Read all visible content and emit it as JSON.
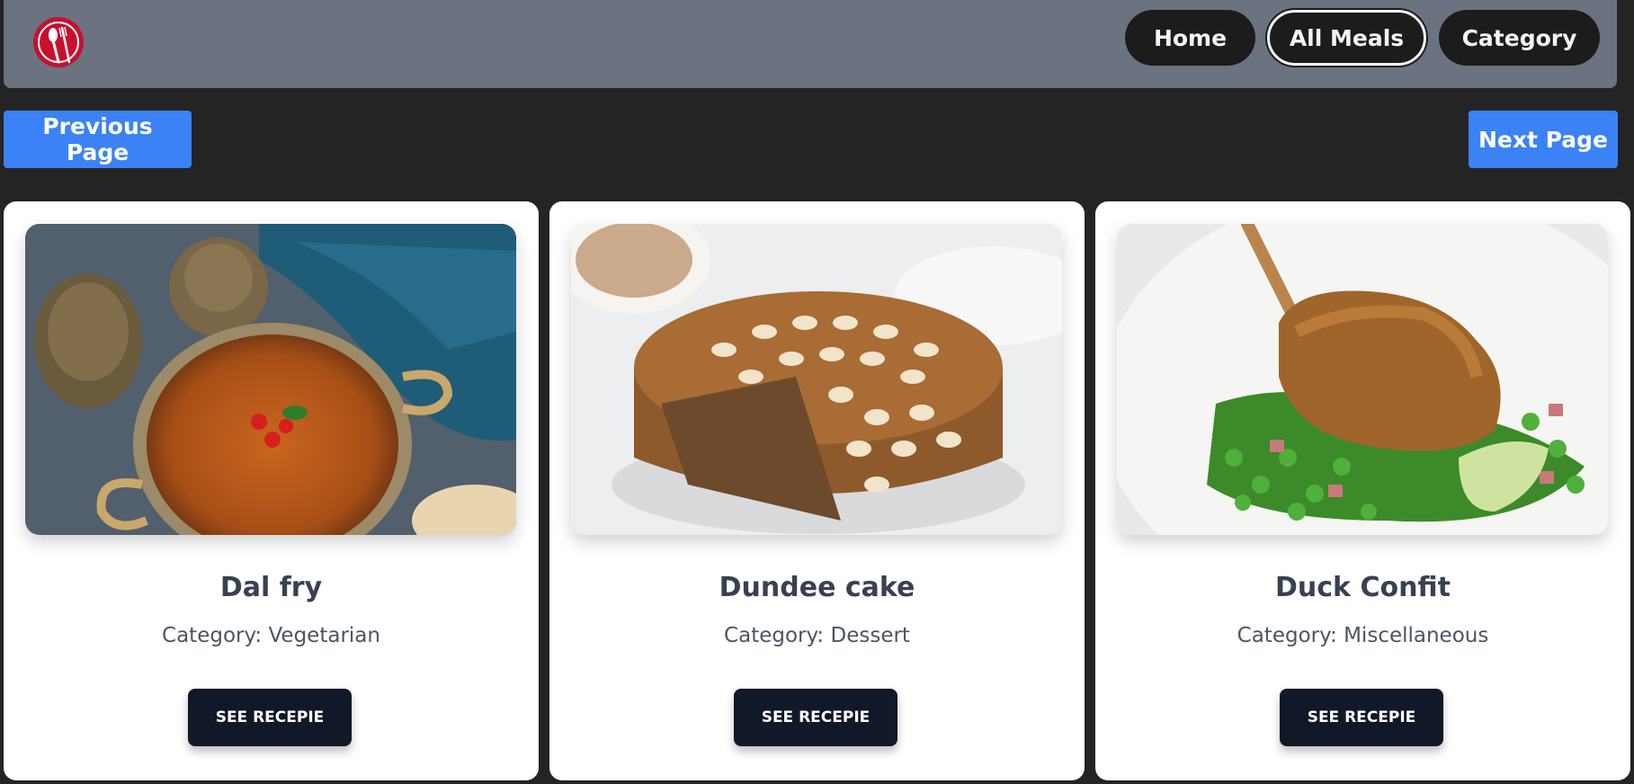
{
  "nav": {
    "home_label": "Home",
    "all_meals_label": "All Meals",
    "category_label": "Category"
  },
  "pagination": {
    "previous_label": "Previous Page",
    "next_label": "Next Page"
  },
  "meals": [
    {
      "title": "Dal fry",
      "category": "Category: Vegetarian",
      "button": "SEE RECEPIE",
      "image": "dal-fry-photo"
    },
    {
      "title": "Dundee cake",
      "category": "Category: Dessert",
      "button": "SEE RECEPIE",
      "image": "dundee-cake-photo"
    },
    {
      "title": "Duck Confit",
      "category": "Category: Miscellaneous",
      "button": "SEE RECEPIE",
      "image": "duck-confit-photo"
    }
  ],
  "colors": {
    "page_bg": "#242424",
    "navbar_bg": "#6b7280",
    "nav_button_bg": "#1c1c1c",
    "pagination_blue": "#3b82f6",
    "card_button_bg": "#111827",
    "logo_red": "#c8102e"
  }
}
